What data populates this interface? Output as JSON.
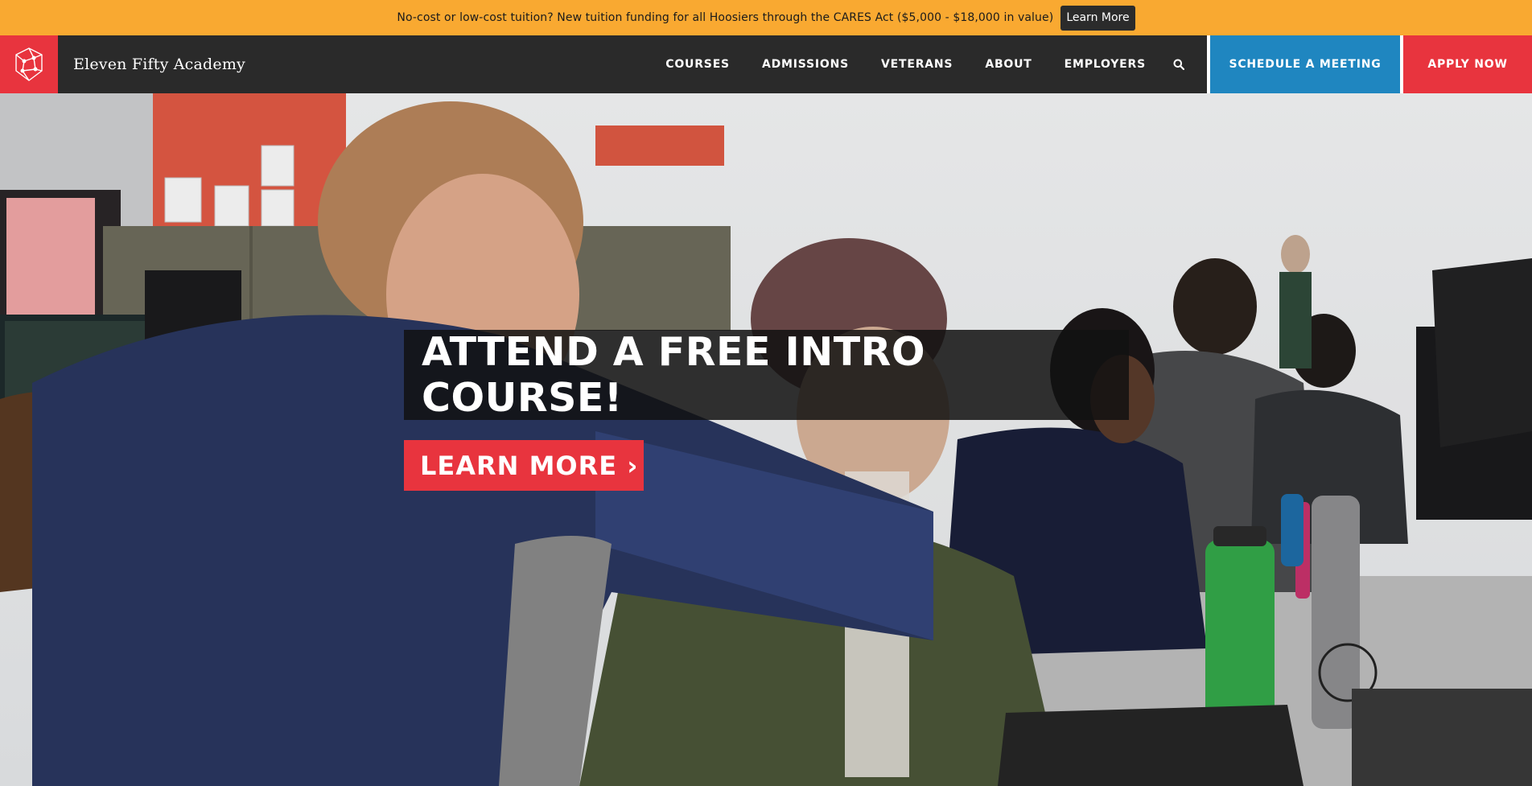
{
  "announcement": {
    "text": "No-cost or low-cost tuition? New tuition funding for all Hoosiers through the CARES Act ($5,000 - $18,000 in value)",
    "button_label": "Learn More"
  },
  "nav": {
    "brand": "Eleven Fifty Academy",
    "logo_icon": "academy-logo-icon",
    "links": [
      "COURSES",
      "ADMISSIONS",
      "VETERANS",
      "ABOUT",
      "EMPLOYERS"
    ],
    "search_icon": "search-icon",
    "schedule_label": "SCHEDULE A MEETING",
    "apply_label": "APPLY NOW"
  },
  "hero": {
    "headline": "ATTEND A FREE INTRO COURSE!",
    "cta_label": "LEARN MORE ›",
    "background": "classroom-photo"
  },
  "colors": {
    "announcement_bg": "#f9a931",
    "nav_bg": "#2a2a2a",
    "brand_red": "#e8343e",
    "schedule_blue": "#1f86c0"
  }
}
